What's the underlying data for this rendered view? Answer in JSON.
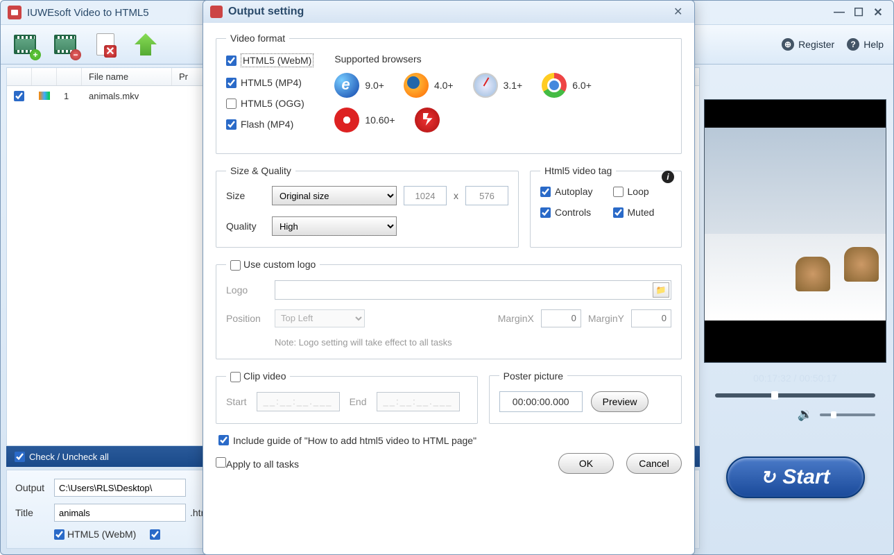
{
  "mainWindow": {
    "title": "IUWEsoft Video to HTML5",
    "toolbar": {
      "registerLabel": "Register",
      "helpLabel": "Help"
    },
    "fileList": {
      "headers": {
        "fileName": "File name",
        "progress": "Pr"
      },
      "rows": [
        {
          "index": "1",
          "fileName": "animals.mkv"
        }
      ]
    },
    "checkAllLabel": "Check / Uncheck all",
    "outputPanel": {
      "outputLabel": "Output",
      "outputPath": "C:\\Users\\RLS\\Desktop\\",
      "titleLabel": "Title",
      "titleValue": "animals",
      "titleExt": ".htn",
      "formats": {
        "webm": "HTML5 (WebM)"
      }
    },
    "preview": {
      "time": "00:17:32 / 00:50:17"
    },
    "startLabel": "Start"
  },
  "dialog": {
    "title": "Output setting",
    "videoFormat": {
      "legend": "Video format",
      "supportedLabel": "Supported browsers",
      "formats": {
        "webm": "HTML5 (WebM)",
        "mp4": "HTML5 (MP4)",
        "ogg": "HTML5 (OGG)",
        "flash": "Flash (MP4)"
      },
      "browsers": {
        "ie": "9.0+",
        "ff": "4.0+",
        "safari": "3.1+",
        "chrome": "6.0+",
        "opera": "10.60+"
      }
    },
    "sizeQuality": {
      "legend": "Size & Quality",
      "sizeLabel": "Size",
      "sizeValue": "Original size",
      "width": "1024",
      "height": "576",
      "x": "x",
      "qualityLabel": "Quality",
      "qualityValue": "High"
    },
    "videoTag": {
      "legend": "Html5 video tag",
      "autoplay": "Autoplay",
      "loop": "Loop",
      "controls": "Controls",
      "muted": "Muted"
    },
    "customLogo": {
      "legend": "Use custom logo",
      "logoLabel": "Logo",
      "positionLabel": "Position",
      "positionValue": "Top Left",
      "marginXLabel": "MarginX",
      "marginXValue": "0",
      "marginYLabel": "MarginY",
      "marginYValue": "0",
      "note": "Note: Logo setting will take effect to all tasks"
    },
    "clipVideo": {
      "legend": "Clip video",
      "startLabel": "Start",
      "startValue": "__:__:__.___",
      "endLabel": "End",
      "endValue": "__:__:__.___"
    },
    "poster": {
      "legend": "Poster picture",
      "value": "00:00:00.000",
      "previewLabel": "Preview"
    },
    "includeGuide": "Include guide of \"How to add html5 video to HTML page\"",
    "applyAll": "Apply to all tasks",
    "ok": "OK",
    "cancel": "Cancel"
  }
}
